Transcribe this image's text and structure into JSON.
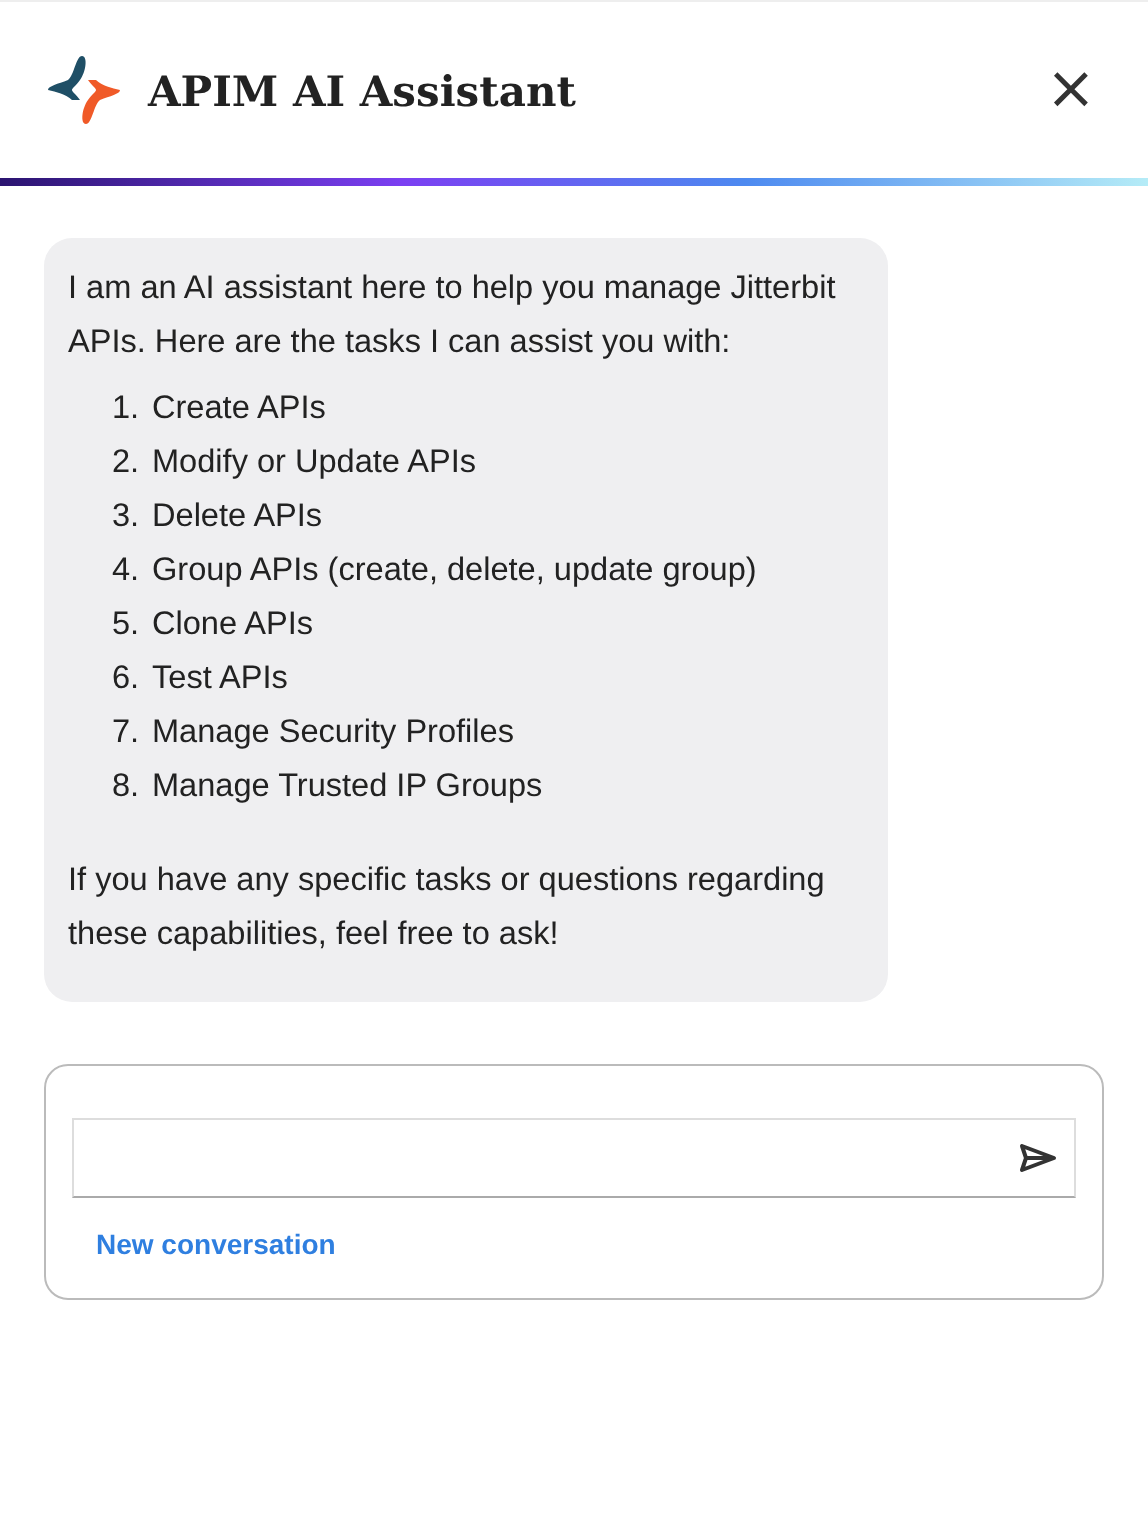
{
  "header": {
    "title": "APIM AI Assistant",
    "close": "×"
  },
  "message": {
    "intro": "I am an AI assistant here to help you manage Jitterbit APIs. Here are the tasks I can assist you with:",
    "tasks": [
      {
        "number": "1.",
        "text": "Create APIs"
      },
      {
        "number": "2.",
        "text": "Modify or Update APIs"
      },
      {
        "number": "3.",
        "text": "Delete APIs"
      },
      {
        "number": "4.",
        "text": "Group APIs (create, delete, update group)"
      },
      {
        "number": "5.",
        "text": "Clone APIs"
      },
      {
        "number": "6.",
        "text": "Test APIs"
      },
      {
        "number": "7.",
        "text": "Manage Security Profiles"
      },
      {
        "number": "8.",
        "text": "Manage Trusted IP Groups"
      }
    ],
    "outro": "If you have any specific tasks or questions regarding these capabilities, feel free to ask!"
  },
  "composer": {
    "new_conversation": "New conversation"
  }
}
